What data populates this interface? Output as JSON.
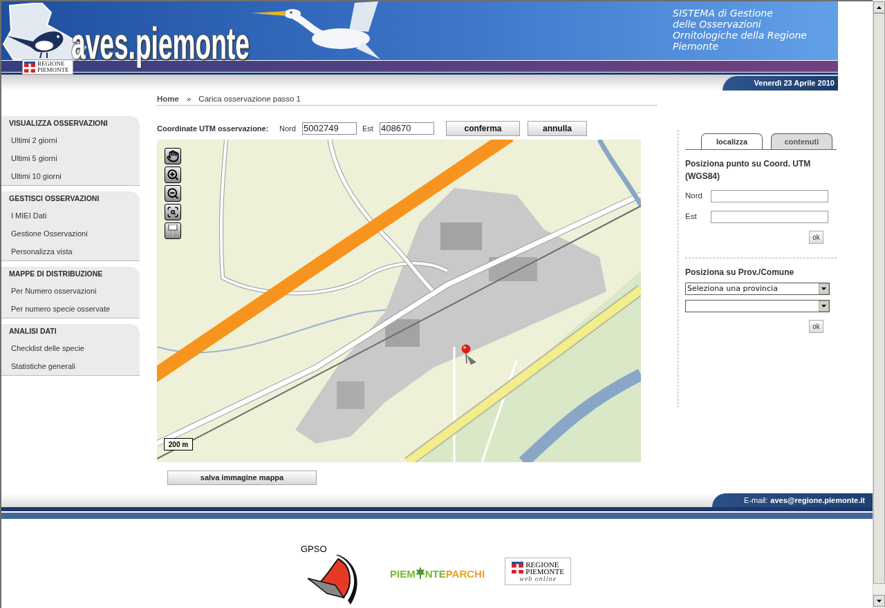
{
  "header": {
    "logo_text": "aves.piemonte",
    "region_badge": [
      "REGIONE",
      "PIEMONTE"
    ],
    "tagline_lines": [
      "SISTEMA di Gestione",
      "delle Osservazioni",
      "Ornitologiche della Regione",
      "Piemonte"
    ],
    "date": "Venerdì 23 Aprile 2010"
  },
  "breadcrumb": [
    {
      "kind": "link",
      "label": "Home"
    },
    {
      "kind": "separator",
      "label": "»"
    },
    {
      "kind": "current",
      "label": "Carica osservazione passo 1"
    }
  ],
  "sidebar": [
    {
      "title": "VISUALIZZA OSSERVAZIONI",
      "items": [
        "Ultimi 2 giorni",
        "Ultimi 5 giorni",
        "Ultimi 10 giorni"
      ]
    },
    {
      "title": "GESTISCI OSSERVAZIONI",
      "items": [
        "I MIEI Dati",
        "Gestione Osservazioni",
        "Personalizza vista"
      ]
    },
    {
      "title": "MAPPE DI DISTRIBUZIONE",
      "items": [
        "Per Numero osservazioni",
        "Per numero specie osservate"
      ]
    },
    {
      "title": "ANALISI DATI",
      "items": [
        "Checklist delle specie",
        "Statistiche generali"
      ]
    }
  ],
  "coordinates": {
    "label": "Coordinate UTM osservazione:",
    "fields": [
      {
        "label": "Nord",
        "value": "5002749"
      },
      {
        "label": "Est",
        "value": "408670"
      }
    ],
    "buttons": [
      "conferma",
      "annulla"
    ]
  },
  "map": {
    "scale": "200 m",
    "save_button": "salva immagine mappa"
  },
  "side_panel": {
    "tabs": [
      {
        "label": "localizza",
        "selected": true
      },
      {
        "label": "contenuti",
        "selected": false
      }
    ],
    "utm": {
      "title": "Posiziona punto su Coord. UTM (WGS84)",
      "fields": [
        {
          "label": "Nord"
        },
        {
          "label": "Est"
        }
      ],
      "button": "ok"
    },
    "area": {
      "title": "Posiziona su Prov./Comune",
      "selects": [
        {
          "kind": "dropdown",
          "value": "Seleziona una provincia"
        },
        {
          "kind": "dropdown"
        }
      ],
      "button": "ok"
    }
  },
  "footer": {
    "email_label": "E-mail:",
    "email": "aves@regione.piemonte.it",
    "logos": [
      {
        "kind": "gpso",
        "text": "GPSO"
      },
      {
        "kind": "parks",
        "parts": [
          "PIEM",
          "NTE",
          "PARCHI"
        ]
      },
      {
        "kind": "region",
        "lines": [
          "REGIONE",
          "PIEMONTE"
        ],
        "tagline": "web online"
      }
    ]
  }
}
